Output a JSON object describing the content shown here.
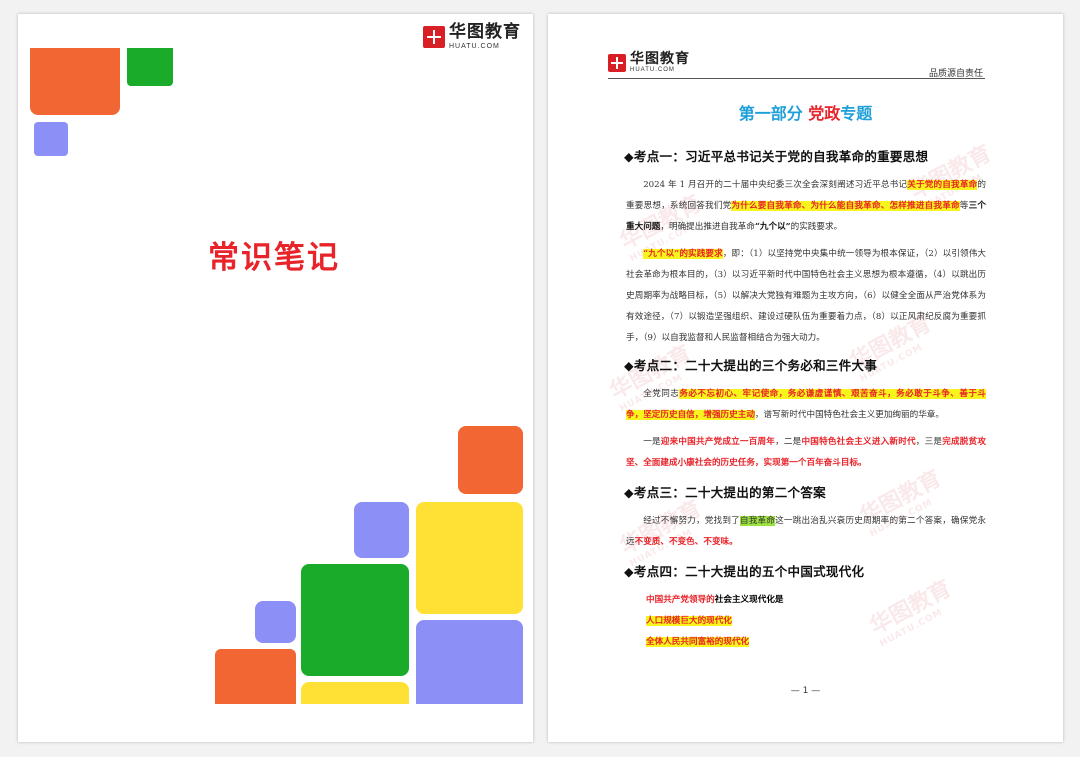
{
  "logo": {
    "cn": "华图教育",
    "en": "HUATU.COM",
    "mark": "H"
  },
  "cover": {
    "title": "常识笔记"
  },
  "header": {
    "right_text": "品质源自责任"
  },
  "part_title": {
    "p1": "第一部分 ",
    "p2": "党政",
    "p3": "专题"
  },
  "watermark": {
    "cn": "华图教育",
    "en": "HUATU.COM"
  },
  "sections": {
    "s1": {
      "heading": "◆考点一：习近平总书记关于党的自我革命的重要思想",
      "p1": {
        "a": "2024 年 1 月召开的二十届中央纪委三次全会深刻阐述习近平总书记",
        "b": "关于党的自我革命",
        "c": "的重要思想，系统回答我们党",
        "d": "为什么要自我革命、为什么能自我革命、怎样推进自我革命",
        "e": "等",
        "f": "三个重大问题",
        "g": "，明确提出推进自我革命",
        "h": "“九个以”",
        "i": "的实践要求。"
      },
      "p2": {
        "a": "“九个以”的实践要求",
        "b": "，即：（1）以坚持党中央集中统一领导为根本保证，（2）以引领伟大社会革命为根本目的，（3）以习近平新时代中国特色社会主义思想为根本遵循，（4）以跳出历史周期率为战略目标，（5）以解决大党独有难题为主攻方向，（6）以健全全面从严治党体系为有效途径，（7）以锻造坚强组织、建设过硬队伍为重要着力点，（8）以正风肃纪反腐为重要抓手，（9）以自我监督和人民监督相结合为强大动力。"
      }
    },
    "s2": {
      "heading": "◆考点二：二十大提出的三个务必和三件大事",
      "p1": {
        "a": "全党同志",
        "b": "务必不忘初心、牢记使命，务必谦虚谨慎、艰苦奋斗，务必敢于斗争、善于斗争，坚定历史自信，增强历史主动",
        "c": "，谱写新时代中国特色社会主义更加绚丽的华章。"
      },
      "p2": {
        "a": "一是",
        "b": "迎来中国共产党成立一百周年",
        "c": "，二是",
        "d": "中国特色社会主义进入新时代",
        "e": "，三是",
        "f": "完成脱贫攻坚、全面建成小康社会的历史任务，实现第一个百年奋斗目标。"
      }
    },
    "s3": {
      "heading": "◆考点三：二十大提出的第二个答案",
      "p1": {
        "a": "经过不懈努力，党找到了",
        "b": "自我革命",
        "c": "这一跳出治乱兴衰历史周期率的第二个答案，确保党永远",
        "d": "不变质、不变色、不变味。"
      }
    },
    "s4": {
      "heading": "◆考点四：二十大提出的五个中国式现代化",
      "l1a": "中国共产党领导的",
      "l1b": "社会主义现代化是",
      "l2": "人口规模巨大的现代化",
      "l3": "全体人民共同富裕的现代化"
    }
  },
  "page_number": "— 1 —",
  "colors": {
    "red": "#e8232a",
    "blue": "#20a0d8",
    "orange": "#f26634",
    "green": "#1aab2a",
    "purple": "#8c8ff5",
    "yellow": "#ffe135"
  }
}
